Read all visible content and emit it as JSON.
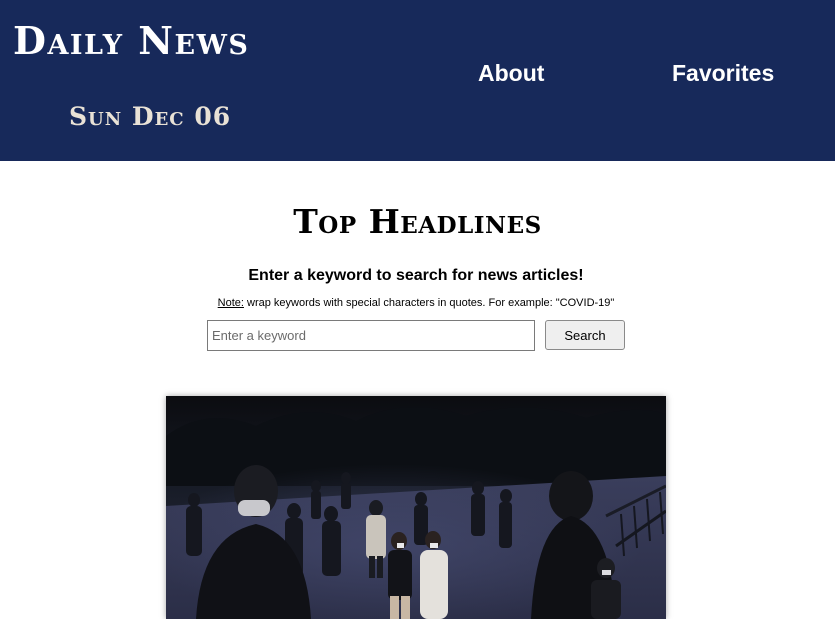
{
  "header": {
    "brand": "Daily News",
    "date": "Sun Dec 06",
    "nav": {
      "about": "About",
      "favorites": "Favorites"
    }
  },
  "main": {
    "title": "Top Headlines",
    "prompt": "Enter a keyword to search for news articles!",
    "note_label": "Note:",
    "note_text": " wrap keywords with special characters in quotes. For example: \"COVID-19\"",
    "search": {
      "placeholder": "Enter a keyword",
      "value": "",
      "button_label": "Search"
    }
  },
  "colors": {
    "header_bg": "#17295a",
    "header_text": "#ffffff",
    "date_text": "#e9e2d6"
  }
}
